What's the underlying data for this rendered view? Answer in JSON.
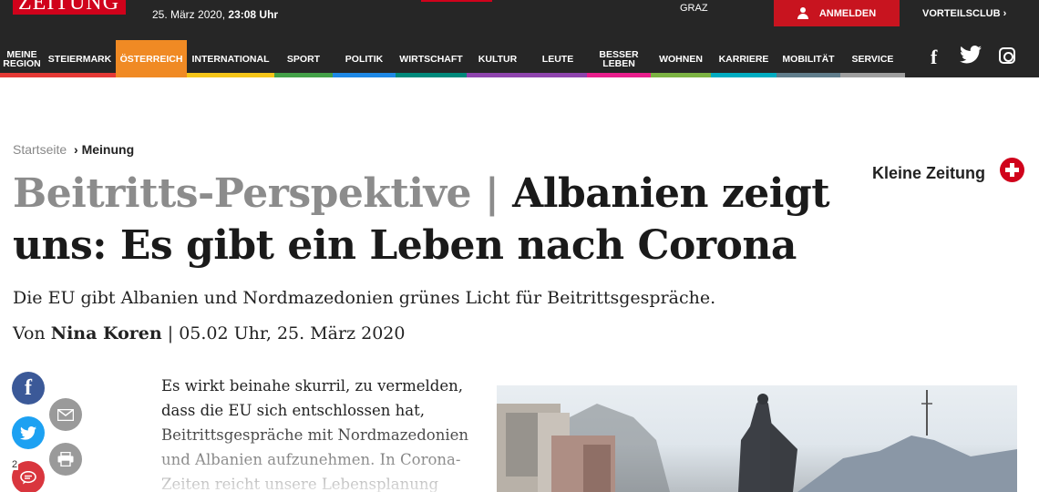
{
  "header": {
    "logo_text": "ZEITUNG",
    "date_prefix": "25. März 2020,",
    "time": "23:08 Uhr",
    "city": "GRAZ",
    "login_label": "ANMELDEN",
    "vorteilsclub_label": "VORTEILSCLUB ›"
  },
  "nav": [
    {
      "label": "MEINE\nREGION",
      "color": "#e53935"
    },
    {
      "label": "STEIERMARK",
      "color": "#e53935"
    },
    {
      "label": "ÖSTERREICH",
      "color": "#f08a24"
    },
    {
      "label": "INTERNATIONAL",
      "color": "#f5c518"
    },
    {
      "label": "SPORT",
      "color": "#43a047"
    },
    {
      "label": "POLITIK",
      "color": "#1e88e5"
    },
    {
      "label": "WIRTSCHAFT",
      "color": "#00897b"
    },
    {
      "label": "KULTUR",
      "color": "#8e44ad"
    },
    {
      "label": "LEUTE",
      "color": "#8e44ad"
    },
    {
      "label": "BESSER\nLEBEN",
      "color": "#e91e8c"
    },
    {
      "label": "WOHNEN",
      "color": "#7cb342"
    },
    {
      "label": "KARRIERE",
      "color": "#00acc1"
    },
    {
      "label": "MOBILITÄT",
      "color": "#607d8b"
    },
    {
      "label": "SERVICE",
      "color": "#9e9e9e"
    }
  ],
  "breadcrumb": {
    "home": "Startseite",
    "separator": "›",
    "current": "Meinung"
  },
  "brand_label": "Kleine Zeitung",
  "article": {
    "kicker": "Beitritts-Perspektive |",
    "title": "Albanien zeigt uns: Es gibt ein Leben nach Corona",
    "lead": "Die EU gibt Albanien und Nordmazedonien grünes Licht für Beitrittsgespräche.",
    "byline_prefix": "Von",
    "author": "Nina Koren",
    "published": "| 05.02 Uhr, 25. März 2020",
    "body_lines": [
      "Es wirkt beinahe skurril, zu vermelden,",
      "dass die EU sich entschlossen hat,",
      "Beitrittsgespräche mit Nordmazedonien",
      "und Albanien aufzunehmen. In Corona-",
      "Zeiten reicht unsere Lebensplanung"
    ]
  },
  "share": {
    "comment_count": "2"
  },
  "icons": [
    "user-icon",
    "facebook-icon",
    "twitter-icon",
    "instagram-icon",
    "plus-icon",
    "mail-icon",
    "print-icon",
    "comment-icon"
  ]
}
